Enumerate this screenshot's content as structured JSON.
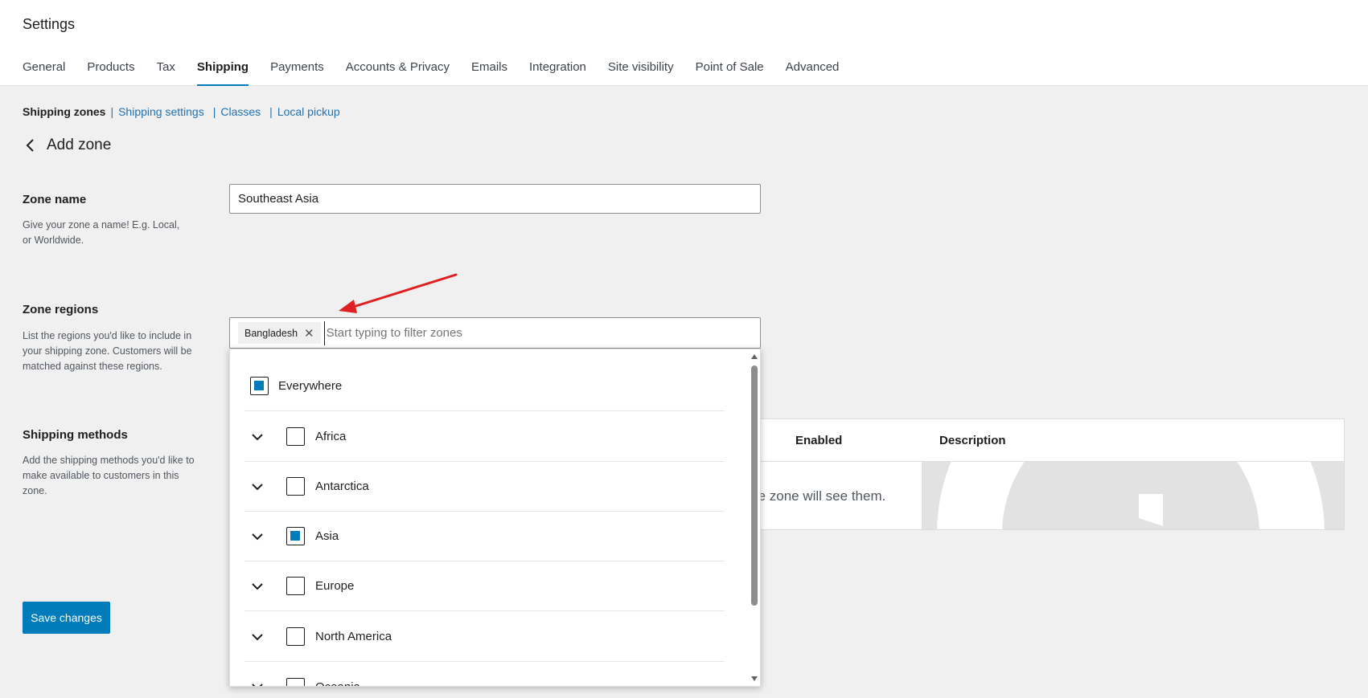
{
  "header": {
    "title": "Settings",
    "tabs": [
      {
        "label": "General"
      },
      {
        "label": "Products"
      },
      {
        "label": "Tax"
      },
      {
        "label": "Shipping",
        "active": true
      },
      {
        "label": "Payments"
      },
      {
        "label": "Accounts & Privacy"
      },
      {
        "label": "Emails"
      },
      {
        "label": "Integration"
      },
      {
        "label": "Site visibility"
      },
      {
        "label": "Point of Sale"
      },
      {
        "label": "Advanced"
      }
    ]
  },
  "subnav": {
    "current": "Shipping zones",
    "links": [
      "Shipping settings",
      "Classes",
      "Local pickup"
    ],
    "separator": "|"
  },
  "page": {
    "back_icon": "chevron-left-icon",
    "heading": "Add zone"
  },
  "zone_name": {
    "label": "Zone name",
    "description": "Give your zone a name! E.g. Local, or Worldwide.",
    "value": "Southeast Asia"
  },
  "zone_regions": {
    "label": "Zone regions",
    "description": "List the regions you'd like to include in your shipping zone. Customers will be matched against these regions.",
    "selected_chip": "Bangladesh",
    "chip_remove": "✕",
    "placeholder": "Start typing to filter zones",
    "options": [
      {
        "label": "Everywhere",
        "checked": true,
        "expandable": false
      },
      {
        "label": "Africa",
        "checked": false,
        "expandable": true
      },
      {
        "label": "Antarctica",
        "checked": false,
        "expandable": true
      },
      {
        "label": "Asia",
        "checked": true,
        "expandable": true
      },
      {
        "label": "Europe",
        "checked": false,
        "expandable": true
      },
      {
        "label": "North America",
        "checked": false,
        "expandable": true
      },
      {
        "label": "Oceania",
        "checked": false,
        "expandable": true
      }
    ]
  },
  "shipping_methods": {
    "label": "Shipping methods",
    "description": "Add the shipping methods you'd like to make available to customers in this zone.",
    "columns": {
      "enabled": "Enabled",
      "description": "Description"
    },
    "empty_text_visible": "hin the zone will see them."
  },
  "actions": {
    "save_label": "Save changes"
  },
  "colors": {
    "accent": "#007cba",
    "annotation_arrow": "#e02020"
  }
}
